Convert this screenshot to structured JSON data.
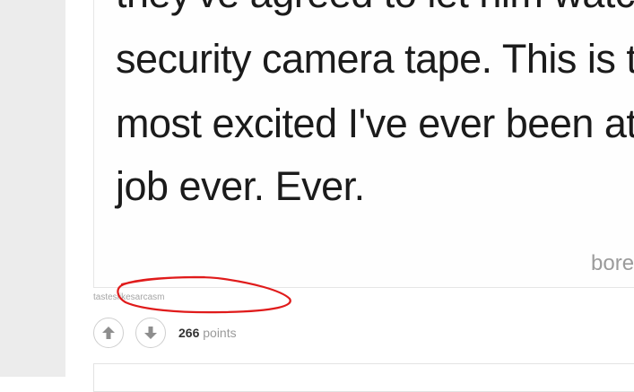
{
  "post": {
    "lines": [
      "they've agreed to let him watch",
      "security camera tape. This is th",
      "most excited I've ever been at",
      "job ever. Ever."
    ],
    "watermark": "bored"
  },
  "meta": {
    "username": "tasteslikesarcasm",
    "points_count": "266",
    "points_label": "points"
  },
  "icons": {
    "upvote": "arrow-up-icon",
    "downvote": "arrow-down-icon"
  },
  "colors": {
    "annotation": "#e01b1b",
    "vote_icon": "#8e8e8e"
  }
}
